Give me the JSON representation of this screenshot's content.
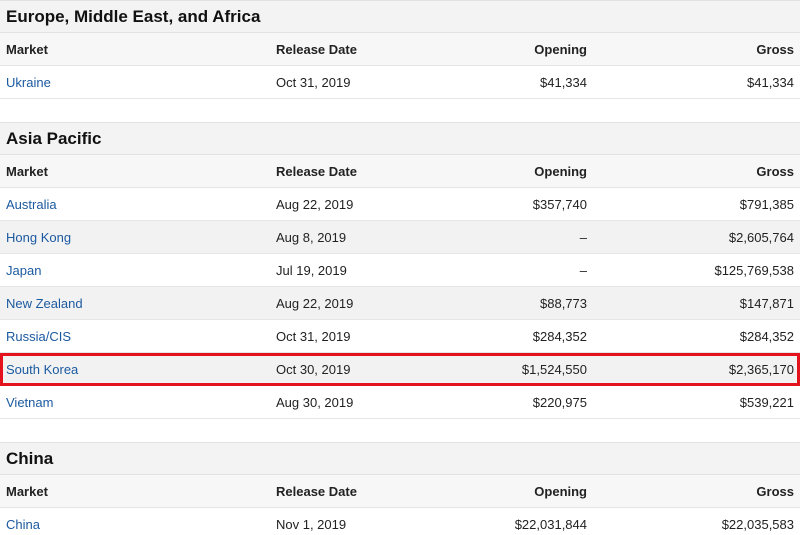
{
  "columns": {
    "market": "Market",
    "release_date": "Release Date",
    "opening": "Opening",
    "gross": "Gross"
  },
  "colors": {
    "link": "#1c5aa0",
    "highlight_border": "#e3121d",
    "section_header_bg": "#f3f3f3"
  },
  "sections": [
    {
      "title": "Europe, Middle East, and Africa",
      "rows": [
        {
          "market": "Ukraine",
          "release_date": "Oct 31, 2019",
          "opening": "$41,334",
          "gross": "$41,334"
        }
      ]
    },
    {
      "title": "Asia Pacific",
      "rows": [
        {
          "market": "Australia",
          "release_date": "Aug 22, 2019",
          "opening": "$357,740",
          "gross": "$791,385"
        },
        {
          "market": "Hong Kong",
          "release_date": "Aug 8, 2019",
          "opening": "–",
          "gross": "$2,605,764"
        },
        {
          "market": "Japan",
          "release_date": "Jul 19, 2019",
          "opening": "–",
          "gross": "$125,769,538"
        },
        {
          "market": "New Zealand",
          "release_date": "Aug 22, 2019",
          "opening": "$88,773",
          "gross": "$147,871"
        },
        {
          "market": "Russia/CIS",
          "release_date": "Oct 31, 2019",
          "opening": "$284,352",
          "gross": "$284,352"
        },
        {
          "market": "South Korea",
          "release_date": "Oct 30, 2019",
          "opening": "$1,524,550",
          "gross": "$2,365,170",
          "highlighted": true
        },
        {
          "market": "Vietnam",
          "release_date": "Aug 30, 2019",
          "opening": "$220,975",
          "gross": "$539,221"
        }
      ]
    },
    {
      "title": "China",
      "rows": [
        {
          "market": "China",
          "release_date": "Nov 1, 2019",
          "opening": "$22,031,844",
          "gross": "$22,035,583"
        }
      ]
    }
  ]
}
